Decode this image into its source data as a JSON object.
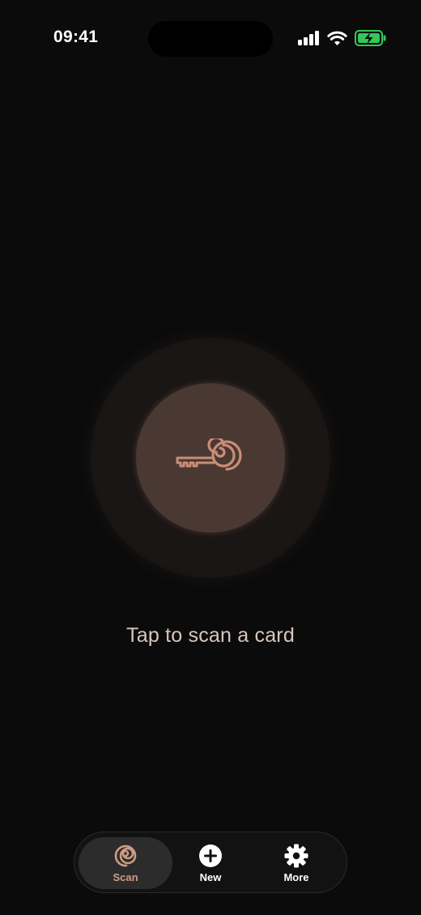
{
  "status_bar": {
    "time": "09:41",
    "icons": [
      "cellular-signal-icon",
      "wifi-icon",
      "battery-charging-icon"
    ],
    "battery_color": "#34c759"
  },
  "main": {
    "scan_button_icon": "key-spiral-icon",
    "prompt": "Tap to scan a card",
    "accent_color": "#c98d76"
  },
  "tab_bar": {
    "tabs": [
      {
        "label": "Scan",
        "icon": "spiral-icon",
        "active": true
      },
      {
        "label": "New",
        "icon": "plus-circle-icon",
        "active": false
      },
      {
        "label": "More",
        "icon": "gear-icon",
        "active": false
      }
    ]
  }
}
